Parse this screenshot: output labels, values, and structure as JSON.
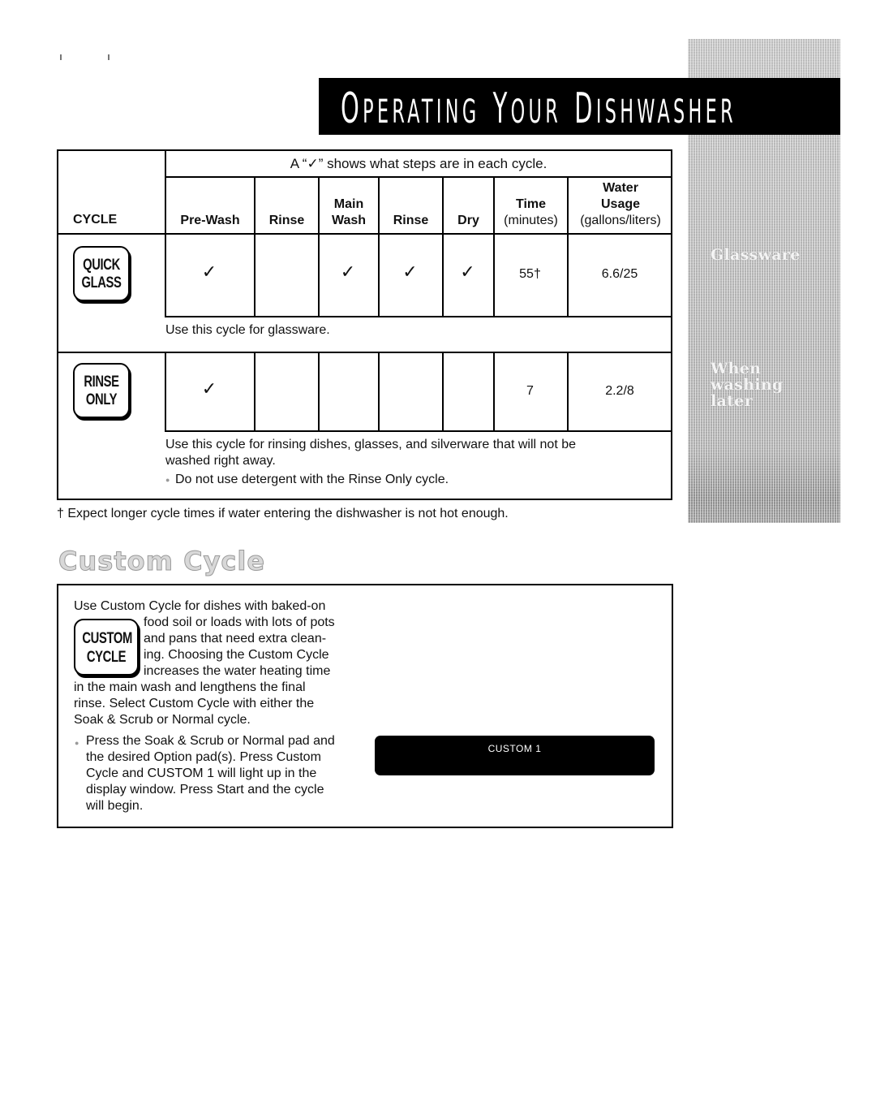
{
  "page": {
    "title": "Operating Your Dishwasher"
  },
  "side_tabs": [
    {
      "label": "Glassware"
    },
    {
      "label_lines": [
        "When",
        "washing",
        "later"
      ]
    }
  ],
  "cycle_table": {
    "caption": "A “✓” shows what steps are in each cycle.",
    "cycle_header": "CYCLE",
    "columns": [
      {
        "line1": "",
        "line2": "",
        "line3": "Pre-Wash"
      },
      {
        "line1": "",
        "line2": "",
        "line3": "Rinse"
      },
      {
        "line1": "",
        "line2": "Main",
        "line3": "Wash"
      },
      {
        "line1": "",
        "line2": "",
        "line3": "Rinse"
      },
      {
        "line1": "",
        "line2": "",
        "line3": "Dry"
      },
      {
        "line1": "",
        "line2": "Time",
        "line3": "(minutes)"
      },
      {
        "line1": "Water",
        "line2": "Usage",
        "line3": "(gallons/liters)"
      }
    ],
    "check_glyph": "✓",
    "rows": [
      {
        "pad_lines": [
          "QUICK",
          "GLASS"
        ],
        "steps": [
          true,
          false,
          true,
          true,
          true
        ],
        "time": "55†",
        "water": "6.6/25",
        "description": [
          "Use this cycle for glassware."
        ],
        "note": ""
      },
      {
        "pad_lines": [
          "RINSE",
          "ONLY"
        ],
        "steps": [
          true,
          false,
          false,
          false,
          false
        ],
        "time": "7",
        "water": "2.2/8",
        "description": [
          "Use this cycle for rinsing dishes, glasses, and silverware that will not be",
          "washed right away."
        ],
        "note": "Do not use detergent with the Rinse Only cycle."
      }
    ],
    "footnote": "† Expect longer cycle times if water entering the dishwasher is not hot enough."
  },
  "custom_cycle": {
    "heading": "Custom Cycle",
    "pad_lines": [
      "CUSTOM",
      "CYCLE"
    ],
    "paragraph_lines": [
      "Use Custom Cycle for dishes with baked-on",
      "food soil or loads with lots of pots",
      "and pans that need extra clean-",
      "ing. Choosing the Custom Cycle",
      "increases the water heating time",
      "in the main wash and lengthens the final",
      "rinse. Select Custom Cycle with either the",
      "Soak & Scrub or Normal cycle."
    ],
    "bullet_lines": [
      "Press the Soak & Scrub or Normal pad and",
      "the desired Option pad(s). Press Custom",
      "Cycle and CUSTOM 1 will light up in the",
      "display window. Press Start and the cycle",
      "will begin."
    ],
    "display_text": "CUSTOM 1"
  },
  "bullet_glyph": "●"
}
